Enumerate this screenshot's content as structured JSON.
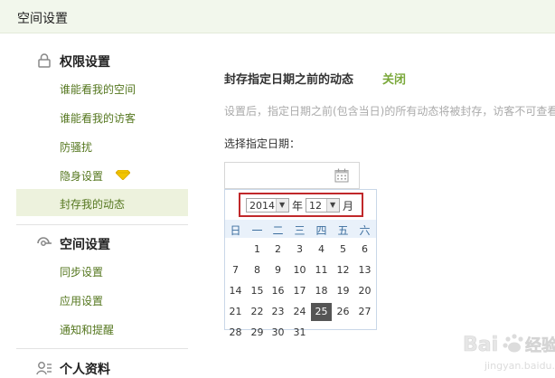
{
  "header": {
    "title": "空间设置"
  },
  "sidebar": {
    "sections": [
      {
        "title": "权限设置",
        "icon": "lock-icon"
      },
      {
        "title": "空间设置",
        "icon": "gear-icon"
      },
      {
        "title": "个人资料",
        "icon": "user-icon"
      }
    ],
    "permission_items": [
      "谁能看我的空间",
      "谁能看我的访客",
      "防骚扰",
      "隐身设置",
      "封存我的动态"
    ],
    "space_items": [
      "同步设置",
      "应用设置",
      "通知和提醒"
    ],
    "active_item": "封存我的动态",
    "diamond_color": "#f2c500"
  },
  "main": {
    "heading": "封存指定日期之前的动态",
    "close_link": "关闭",
    "description": "设置后，指定日期之前(包含当日)的所有动态将被封存，访客不可查看",
    "date_label": "选择指定日期："
  },
  "calendar": {
    "year": "2014",
    "year_suffix": "年",
    "month": "12",
    "month_suffix": "月",
    "weekdays": [
      "日",
      "一",
      "二",
      "三",
      "四",
      "五",
      "六"
    ],
    "weeks": [
      [
        "",
        "1",
        "2",
        "3",
        "4",
        "5",
        "6"
      ],
      [
        "7",
        "8",
        "9",
        "10",
        "11",
        "12",
        "13"
      ],
      [
        "14",
        "15",
        "16",
        "17",
        "18",
        "19",
        "20"
      ],
      [
        "21",
        "22",
        "23",
        "24",
        "25",
        "26",
        "27"
      ],
      [
        "28",
        "29",
        "30",
        "31",
        "",
        "",
        ""
      ]
    ],
    "selected_day": "25",
    "highlight_color": "#c0282a"
  }
}
